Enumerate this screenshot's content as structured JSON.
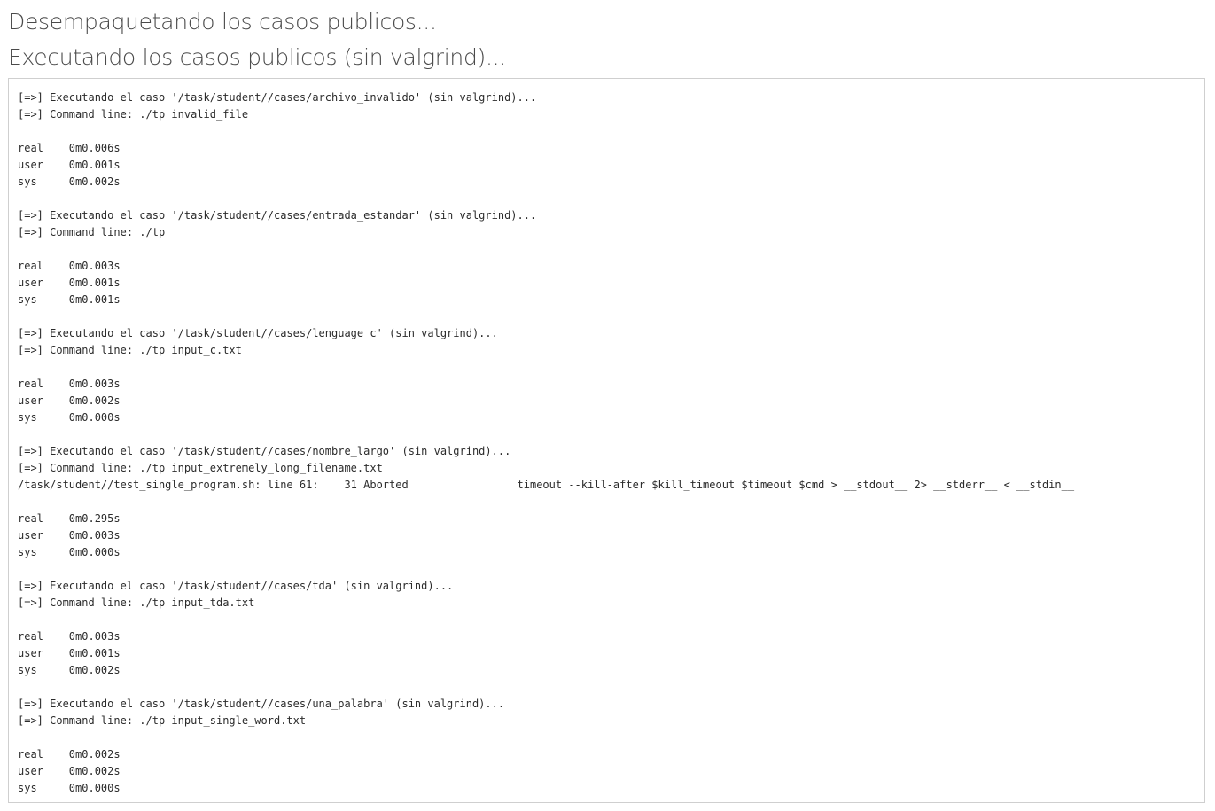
{
  "headings": {
    "unpacking": "Desempaquetando los casos publicos...",
    "executing": "Executando los casos publicos (sin valgrind)..."
  },
  "console_lines": [
    "[=>] Executando el caso '/task/student//cases/archivo_invalido' (sin valgrind)...",
    "[=>] Command line: ./tp invalid_file",
    "",
    "real\t0m0.006s",
    "user\t0m0.001s",
    "sys\t0m0.002s",
    "",
    "[=>] Executando el caso '/task/student//cases/entrada_estandar' (sin valgrind)...",
    "[=>] Command line: ./tp",
    "",
    "real\t0m0.003s",
    "user\t0m0.001s",
    "sys\t0m0.001s",
    "",
    "[=>] Executando el caso '/task/student//cases/lenguage_c' (sin valgrind)...",
    "[=>] Command line: ./tp input_c.txt",
    "",
    "real\t0m0.003s",
    "user\t0m0.002s",
    "sys\t0m0.000s",
    "",
    "[=>] Executando el caso '/task/student//cases/nombre_largo' (sin valgrind)...",
    "[=>] Command line: ./tp input_extremely_long_filename.txt",
    "/task/student//test_single_program.sh: line 61:    31 Aborted                 timeout --kill-after $kill_timeout $timeout $cmd > __stdout__ 2> __stderr__ < __stdin__",
    "",
    "real\t0m0.295s",
    "user\t0m0.003s",
    "sys\t0m0.000s",
    "",
    "[=>] Executando el caso '/task/student//cases/tda' (sin valgrind)...",
    "[=>] Command line: ./tp input_tda.txt",
    "",
    "real\t0m0.003s",
    "user\t0m0.001s",
    "sys\t0m0.002s",
    "",
    "[=>] Executando el caso '/task/student//cases/una_palabra' (sin valgrind)...",
    "[=>] Command line: ./tp input_single_word.txt",
    "",
    "real\t0m0.002s",
    "user\t0m0.002s",
    "sys\t0m0.000s"
  ]
}
